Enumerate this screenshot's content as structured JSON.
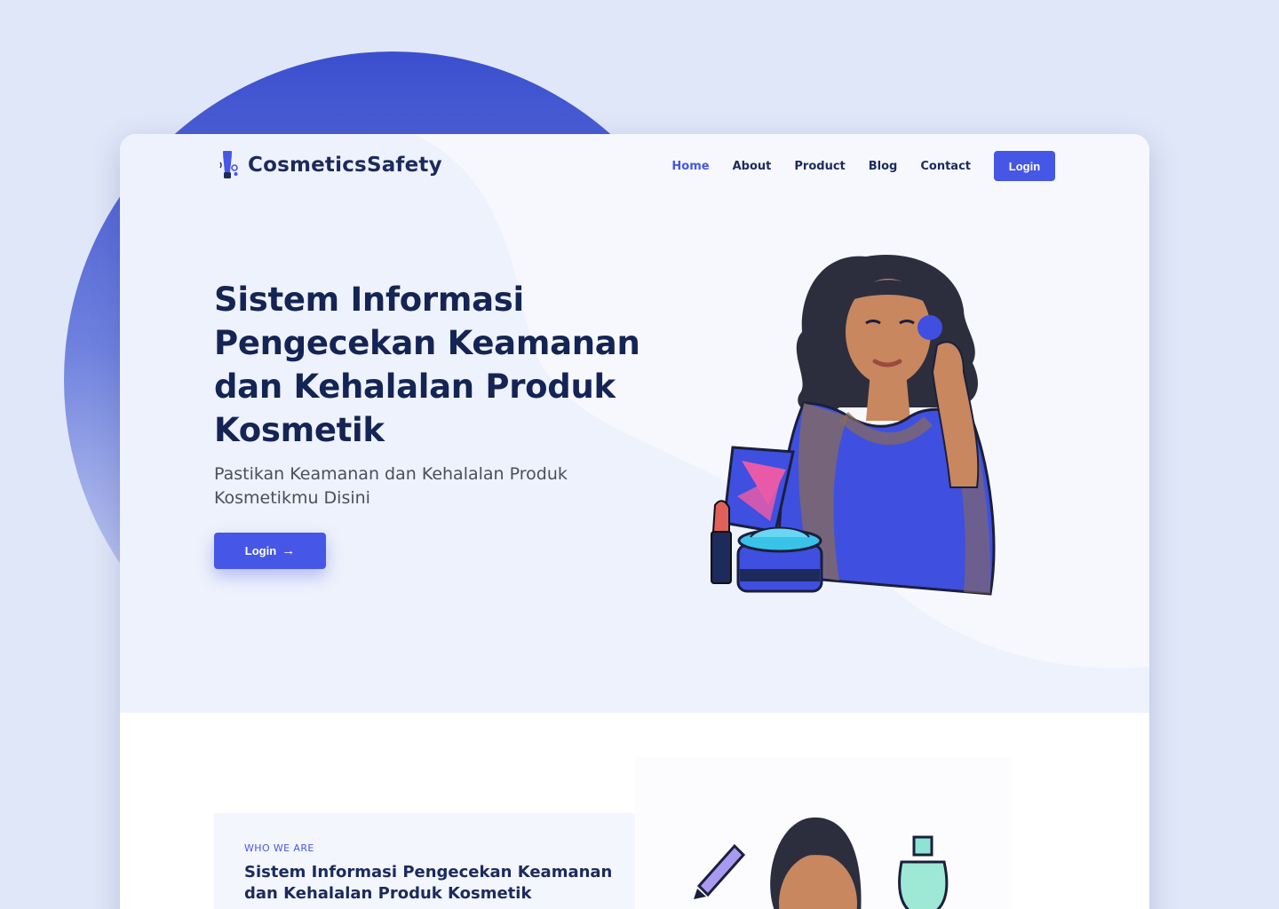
{
  "brand": {
    "name": "CosmeticsSafety",
    "logo_icon": "cosmetic-tube-icon"
  },
  "nav": {
    "items": [
      {
        "label": "Home",
        "active": true
      },
      {
        "label": "About",
        "active": false
      },
      {
        "label": "Product",
        "active": false
      },
      {
        "label": "Blog",
        "active": false
      },
      {
        "label": "Contact",
        "active": false
      }
    ],
    "login_label": "Login"
  },
  "hero": {
    "title": "Sistem Informasi Pengecekan Keamanan dan Kehalalan Produk Kosmetik",
    "subtitle": "Pastikan Keamanan dan Kehalalan Produk Kosmetikmu Disini",
    "cta_label": "Login",
    "cta_icon": "arrow-right-icon"
  },
  "about": {
    "kicker": "WHO WE ARE",
    "title": "Sistem Informasi Pengecekan Keamanan dan Kehalalan Produk Kosmetik"
  },
  "colors": {
    "accent": "#4656e6",
    "heading": "#142454",
    "page_background": "#e0e7f8",
    "hero_background": "#f0f4fd"
  }
}
